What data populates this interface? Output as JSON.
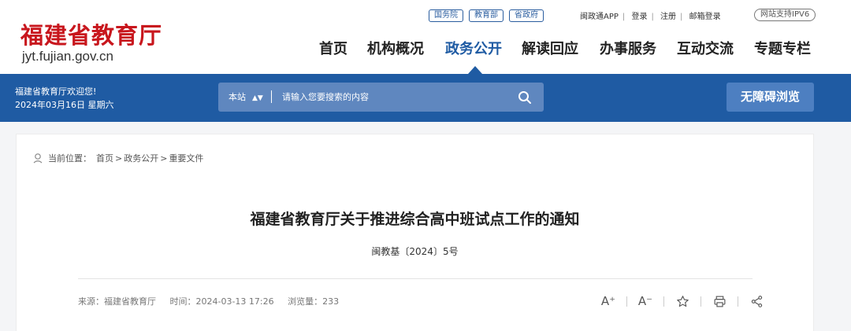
{
  "logo": {
    "cn": "福建省教育厅",
    "en": "jyt.fujian.gov.cn"
  },
  "top_links": {
    "gov": [
      "国务院",
      "教育部",
      "省政府"
    ],
    "app": "闽政通APP",
    "login": "登录",
    "register": "注册",
    "mail": "邮箱登录",
    "ipv6": "网站支持IPV6"
  },
  "nav": {
    "items": [
      {
        "label": "首页"
      },
      {
        "label": "机构概况"
      },
      {
        "label": "政务公开"
      },
      {
        "label": "解读回应"
      },
      {
        "label": "办事服务"
      },
      {
        "label": "互动交流"
      },
      {
        "label": "专题专栏"
      }
    ],
    "active": "政务公开"
  },
  "bar": {
    "welcome": "福建省教育厅欢迎您!",
    "date": "2024年03月16日 星期六",
    "search_scope": "本站",
    "search_placeholder": "请输入您要搜索的内容",
    "accessibility": "无障碍浏览"
  },
  "breadcrumb": {
    "prefix": "当前位置：",
    "items": [
      "首页",
      "政务公开",
      "重要文件"
    ]
  },
  "article": {
    "title": "福建省教育厅关于推进综合高中班试点工作的通知",
    "doc_no": "闽教基〔2024〕5号",
    "source": "来源：福建省教育厅",
    "time": "时间：2024-03-13 17:26",
    "views": "浏览量：233"
  },
  "tools": {
    "enlarge": "A⁺",
    "shrink": "A⁻"
  },
  "colors": {
    "brand_red": "#c8161d",
    "brand_blue": "#1f5ba3"
  }
}
